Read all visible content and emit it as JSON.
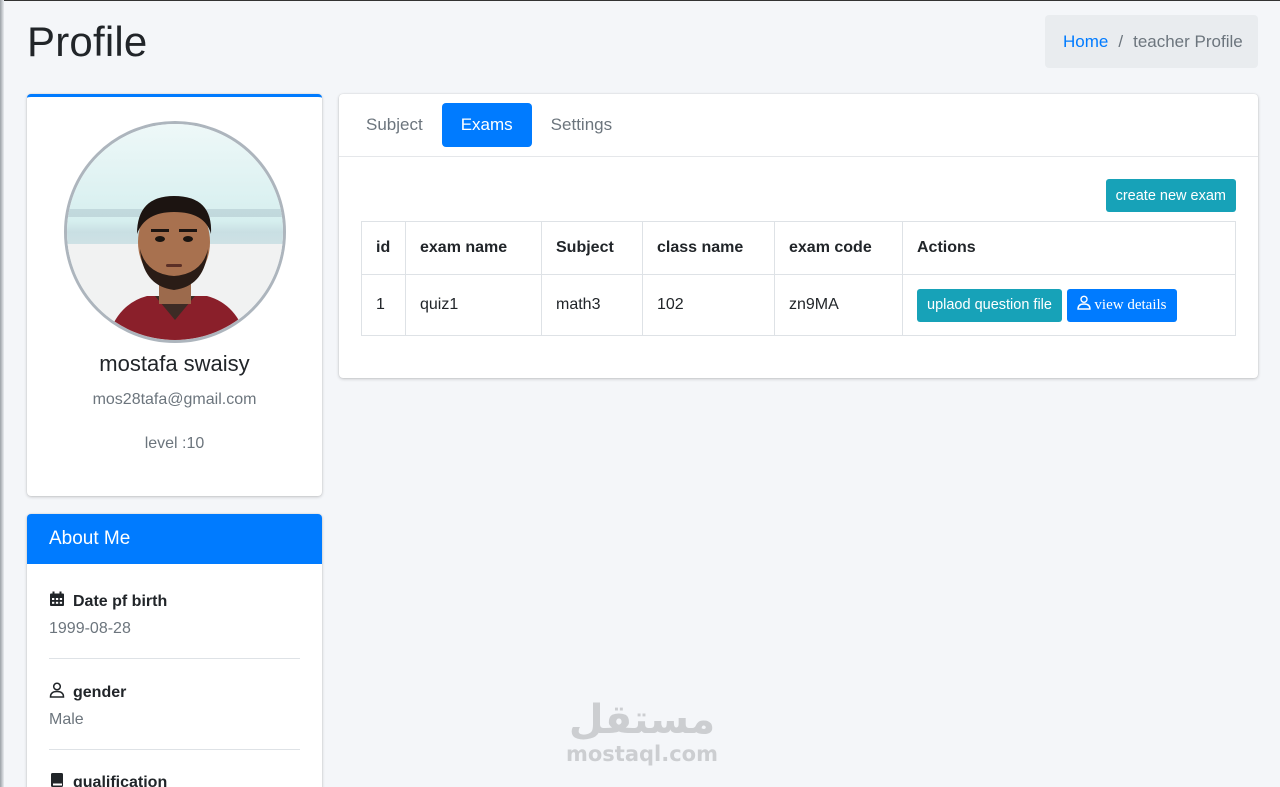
{
  "page": {
    "title": "Profile"
  },
  "breadcrumb": {
    "home": "Home",
    "separator": "/",
    "current": "teacher Profile"
  },
  "profile": {
    "name": "mostafa swaisy",
    "email": "mos28tafa@gmail.com",
    "level": "level :10"
  },
  "about": {
    "title": "About Me",
    "items": [
      {
        "icon": "calendar-icon",
        "label": "Date pf birth",
        "value": "1999-08-28"
      },
      {
        "icon": "user-icon",
        "label": "gender",
        "value": "Male"
      },
      {
        "icon": "book-icon",
        "label": "qualification",
        "value": ""
      }
    ]
  },
  "tabs": [
    {
      "label": "Subject",
      "active": false
    },
    {
      "label": "Exams",
      "active": true
    },
    {
      "label": "Settings",
      "active": false
    }
  ],
  "exams": {
    "create_button": "create new exam",
    "columns": [
      "id",
      "exam name",
      "Subject",
      "class name",
      "exam code",
      "Actions"
    ],
    "rows": [
      {
        "id": "1",
        "exam_name": "quiz1",
        "subject": "math3",
        "class_name": "102",
        "exam_code": "zn9MA",
        "upload_label": "uplaod question file",
        "view_label": "view details"
      }
    ]
  },
  "watermark": {
    "arabic": "مستقل",
    "latin": "mostaql.com"
  },
  "colors": {
    "primary": "#007bff",
    "info": "#17a2b8",
    "background": "#f4f6f9"
  }
}
